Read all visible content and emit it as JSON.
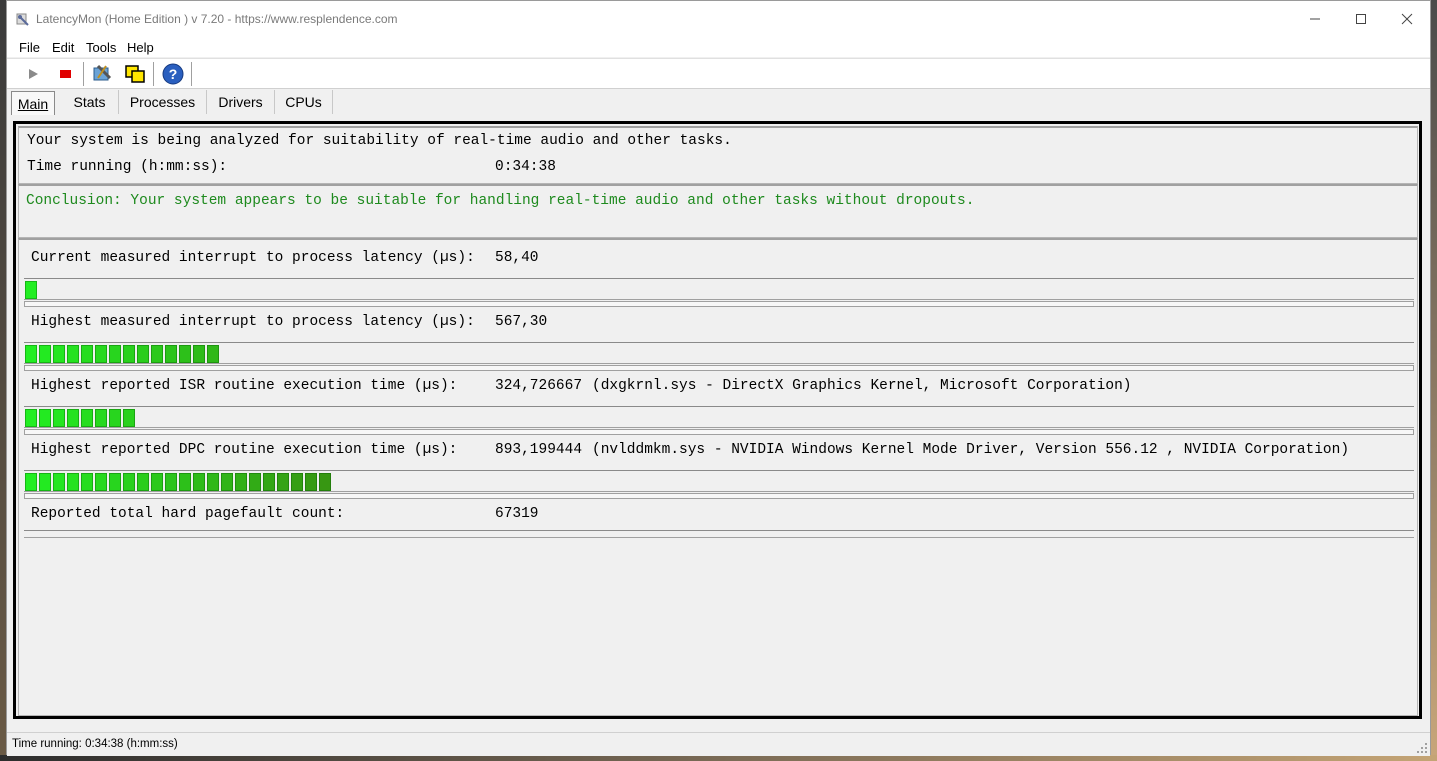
{
  "window": {
    "title": "LatencyMon  (Home Edition )  v 7.20 - https://www.resplendence.com"
  },
  "menu": [
    {
      "label": "File"
    },
    {
      "label": "Edit"
    },
    {
      "label": "Tools"
    },
    {
      "label": "Help"
    }
  ],
  "toolbar": {
    "icons": [
      "play-icon",
      "stop-icon",
      "tools-icon",
      "copy-windows-icon",
      "help-icon"
    ]
  },
  "tabs": [
    {
      "label": "Main",
      "active": true
    },
    {
      "label": "Stats"
    },
    {
      "label": "Processes"
    },
    {
      "label": "Drivers"
    },
    {
      "label": "CPUs"
    }
  ],
  "status": {
    "line1": "Your system is being analyzed for suitability of real-time audio and other tasks.",
    "time_label": "Time running (h:mm:ss):",
    "time_value": "0:34:38"
  },
  "conclusion": {
    "text": "Conclusion: Your system appears to be suitable for handling real-time audio and other tasks without dropouts.",
    "color": "#1e8a1e"
  },
  "metrics": [
    {
      "label": "Current measured interrupt to process latency (µs):",
      "value": "58,40",
      "detail": "",
      "bar_segments": 1
    },
    {
      "label": "Highest measured interrupt to process latency (µs):",
      "value": "567,30",
      "detail": "",
      "bar_segments": 14
    },
    {
      "label": "Highest reported ISR routine execution time (µs):",
      "value": "324,726667",
      "detail": "(dxgkrnl.sys - DirectX Graphics Kernel, Microsoft Corporation)",
      "bar_segments": 8
    },
    {
      "label": "Highest reported DPC routine execution time (µs):",
      "value": "893,199444",
      "detail": "(nvlddmkm.sys - NVIDIA Windows Kernel Mode Driver, Version 556.12 , NVIDIA Corporation)",
      "bar_segments": 22
    },
    {
      "label": "Reported total hard pagefault count:",
      "value": "67319",
      "detail": "",
      "bar_segments": 0
    }
  ],
  "statusbar": {
    "text": "Time running: 0:34:38  (h:mm:ss)"
  },
  "colors": {
    "bar_light": "#22ee22",
    "bar_dark": "#3a8a10"
  }
}
